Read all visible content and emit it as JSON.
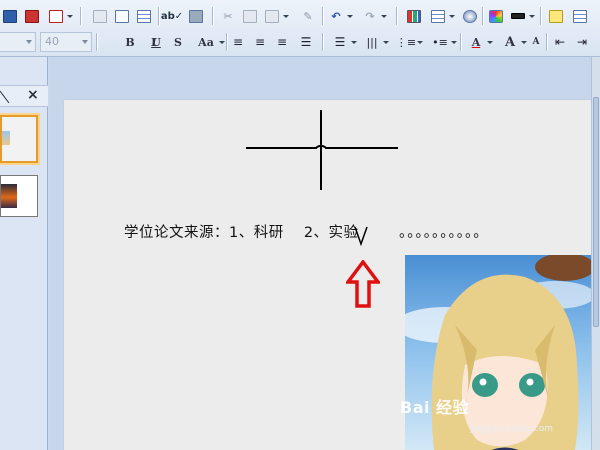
{
  "toolbar": {
    "row1_buttons": [
      "save-icon",
      "print-icon",
      "pdf-icon",
      "print-preview-icon",
      "print-setup-icon",
      "spellcheck-icon",
      "research-icon",
      "cut-icon",
      "copy-icon",
      "paste-icon",
      "format-painter-icon",
      "undo-icon",
      "redo-icon",
      "chart-icon",
      "table-icon",
      "color-swatch-icon",
      "color-scheme-icon",
      "line-style-icon",
      "new-slide-icon",
      "slide-layout-icon"
    ],
    "font_name_value": "",
    "font_size_value": "40",
    "bold": "B",
    "italic": "I",
    "underline": "U",
    "strikethrough": "S",
    "change_case": "Aa",
    "font_color": "A",
    "grow_font": "A",
    "shrink_font": "A"
  },
  "left_panel": {
    "close_label": "×",
    "thumbnails": [
      {
        "name": "slide-1",
        "selected": true
      },
      {
        "name": "slide-2",
        "selected": false
      }
    ]
  },
  "slide": {
    "source_text": "学位论文来源：1、科研　 2、实验",
    "dots_text": "。。。。。。。。。。",
    "watermark_text": "Bai 经验",
    "watermark_url": "jingyan.baidu.com"
  },
  "colors": {
    "arrow_red": "#e01010",
    "selected_thumb_border": "#e59a2c",
    "slide_background": "#ececec"
  }
}
